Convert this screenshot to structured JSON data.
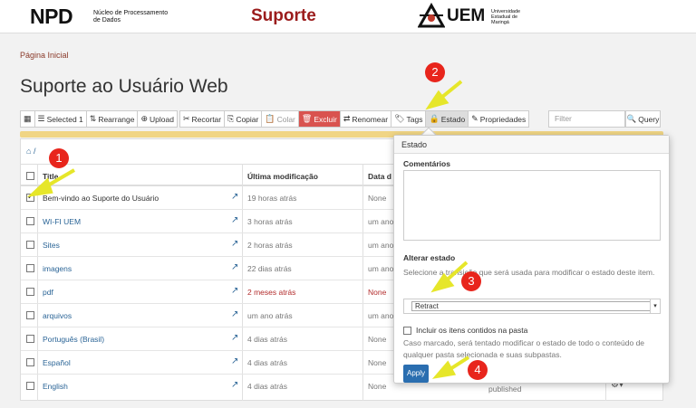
{
  "header": {
    "brand": "NPD",
    "brand_sub": "Núcleo de Processamento de Dados",
    "site_title": "Suporte",
    "uni": "UEM",
    "uni_sub": "Universidade Estadual de Maringá"
  },
  "breadcrumb": "Página Inicial",
  "page_title": "Suporte ao Usuário Web",
  "toolbar": {
    "selected": "Selected 1",
    "rearrange": "Rearrange",
    "upload": "Upload",
    "cut": "Recortar",
    "copy": "Copiar",
    "paste": "Colar",
    "delete": "Excluir",
    "rename": "Renomear",
    "tags": "Tags",
    "state": "Estado",
    "properties": "Propriedades",
    "filter_placeholder": "Filter",
    "query": "Query"
  },
  "path": "/",
  "table": {
    "columns": [
      "Title",
      "Última modificação",
      "Data d"
    ],
    "rows": [
      {
        "title": "Bem-vindo ao Suporte do Usuário",
        "modified": "19 horas atrás",
        "date": "None",
        "checked": true
      },
      {
        "title": "WI-FI UEM",
        "modified": "3 horas atrás",
        "date": "um ano"
      },
      {
        "title": "Sites",
        "modified": "2 horas atrás",
        "date": "um ano"
      },
      {
        "title": "imagens",
        "modified": "22 dias atrás",
        "date": "um ano"
      },
      {
        "title": "pdf",
        "modified": "2 meses atrás",
        "date": "None"
      },
      {
        "title": "arquivos",
        "modified": "um ano atrás",
        "date": "um ano"
      },
      {
        "title": "Português (Brasil)",
        "modified": "4 dias atrás",
        "date": "None"
      },
      {
        "title": "Español",
        "modified": "4 dias atrás",
        "date": "None"
      },
      {
        "title": "English",
        "modified": "4 dias atrás",
        "date": "None",
        "status": "published"
      }
    ]
  },
  "popover": {
    "title": "Estado",
    "comments_label": "Comentários",
    "state_label": "Alterar estado",
    "state_help": "Selecione a transição que será usada para modificar o estado deste item.",
    "state_value": "Retract",
    "include_label": "Incluir os itens contidos na pasta",
    "include_help": "Caso marcado, será tentado modificar o estado de todo o conteúdo de qualquer pasta selecionada e suas subpastas.",
    "apply": "Apply"
  },
  "annotations": [
    "1",
    "2",
    "3",
    "4"
  ],
  "colors": {
    "badge": "#e8251c",
    "arrow": "#e6e62a",
    "delete": "#d9534f",
    "primary": "#2a6eb0"
  }
}
